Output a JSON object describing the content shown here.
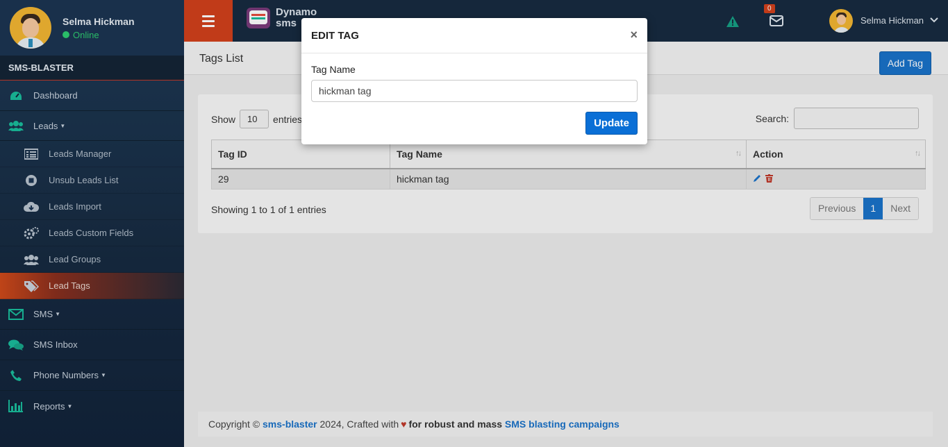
{
  "sidebar": {
    "user": {
      "name": "Selma Hickman",
      "status": "Online"
    },
    "brand": "SMS-BLASTER",
    "menu": [
      {
        "label": "Dashboard",
        "icon": "dashboard-icon"
      },
      {
        "label": "Leads",
        "icon": "users-icon",
        "has_caret": true
      },
      {
        "label": "SMS",
        "icon": "envelope-icon",
        "has_caret": true
      },
      {
        "label": "SMS Inbox",
        "icon": "chat-icon"
      },
      {
        "label": "Phone Numbers",
        "icon": "phone-icon",
        "has_caret": true
      },
      {
        "label": "Reports",
        "icon": "bar-chart-icon",
        "has_caret": true
      }
    ],
    "leads_submenu": [
      {
        "label": "Leads Manager",
        "icon": "list-icon"
      },
      {
        "label": "Unsub Leads List",
        "icon": "stop-icon"
      },
      {
        "label": "Leads Import",
        "icon": "cloud-download-icon"
      },
      {
        "label": "Leads Custom Fields",
        "icon": "gears-icon"
      },
      {
        "label": "Lead Groups",
        "icon": "group-icon"
      },
      {
        "label": "Lead Tags",
        "icon": "tags-icon",
        "active": true
      }
    ]
  },
  "topbar": {
    "logo_line1": "Dynamo",
    "logo_line2": "sms",
    "mail_count": "0",
    "user_name": "Selma Hickman"
  },
  "page": {
    "title": "Tags List",
    "add_button": "Add Tag",
    "show_label": "Show",
    "entries_label": "entries",
    "page_length": "10",
    "search_label": "Search:",
    "columns": [
      "Tag ID",
      "Tag Name",
      "Action"
    ],
    "rows": [
      {
        "id": "29",
        "name": "hickman tag"
      }
    ],
    "info": "Showing 1 to 1 of 1 entries",
    "pagination": {
      "previous": "Previous",
      "current": "1",
      "next": "Next"
    }
  },
  "footer": {
    "copyright": "Copyright ©",
    "site_link": "sms-blaster",
    "year_text": "2024, Crafted with",
    "tagline_bold": "for robust and mass",
    "tagline_link": "SMS blasting campaigns"
  },
  "modal": {
    "title": "EDIT TAG",
    "close": "×",
    "field_label": "Tag Name",
    "field_value": "hickman tag",
    "submit": "Update"
  },
  "colors": {
    "accent": "#1a72c9",
    "sidebar_bg": "#1c3552",
    "topbar_bg": "#172b40",
    "active_menu": "#d04a1b",
    "online": "#2ecc71",
    "icon_teal": "#1abc9c"
  }
}
